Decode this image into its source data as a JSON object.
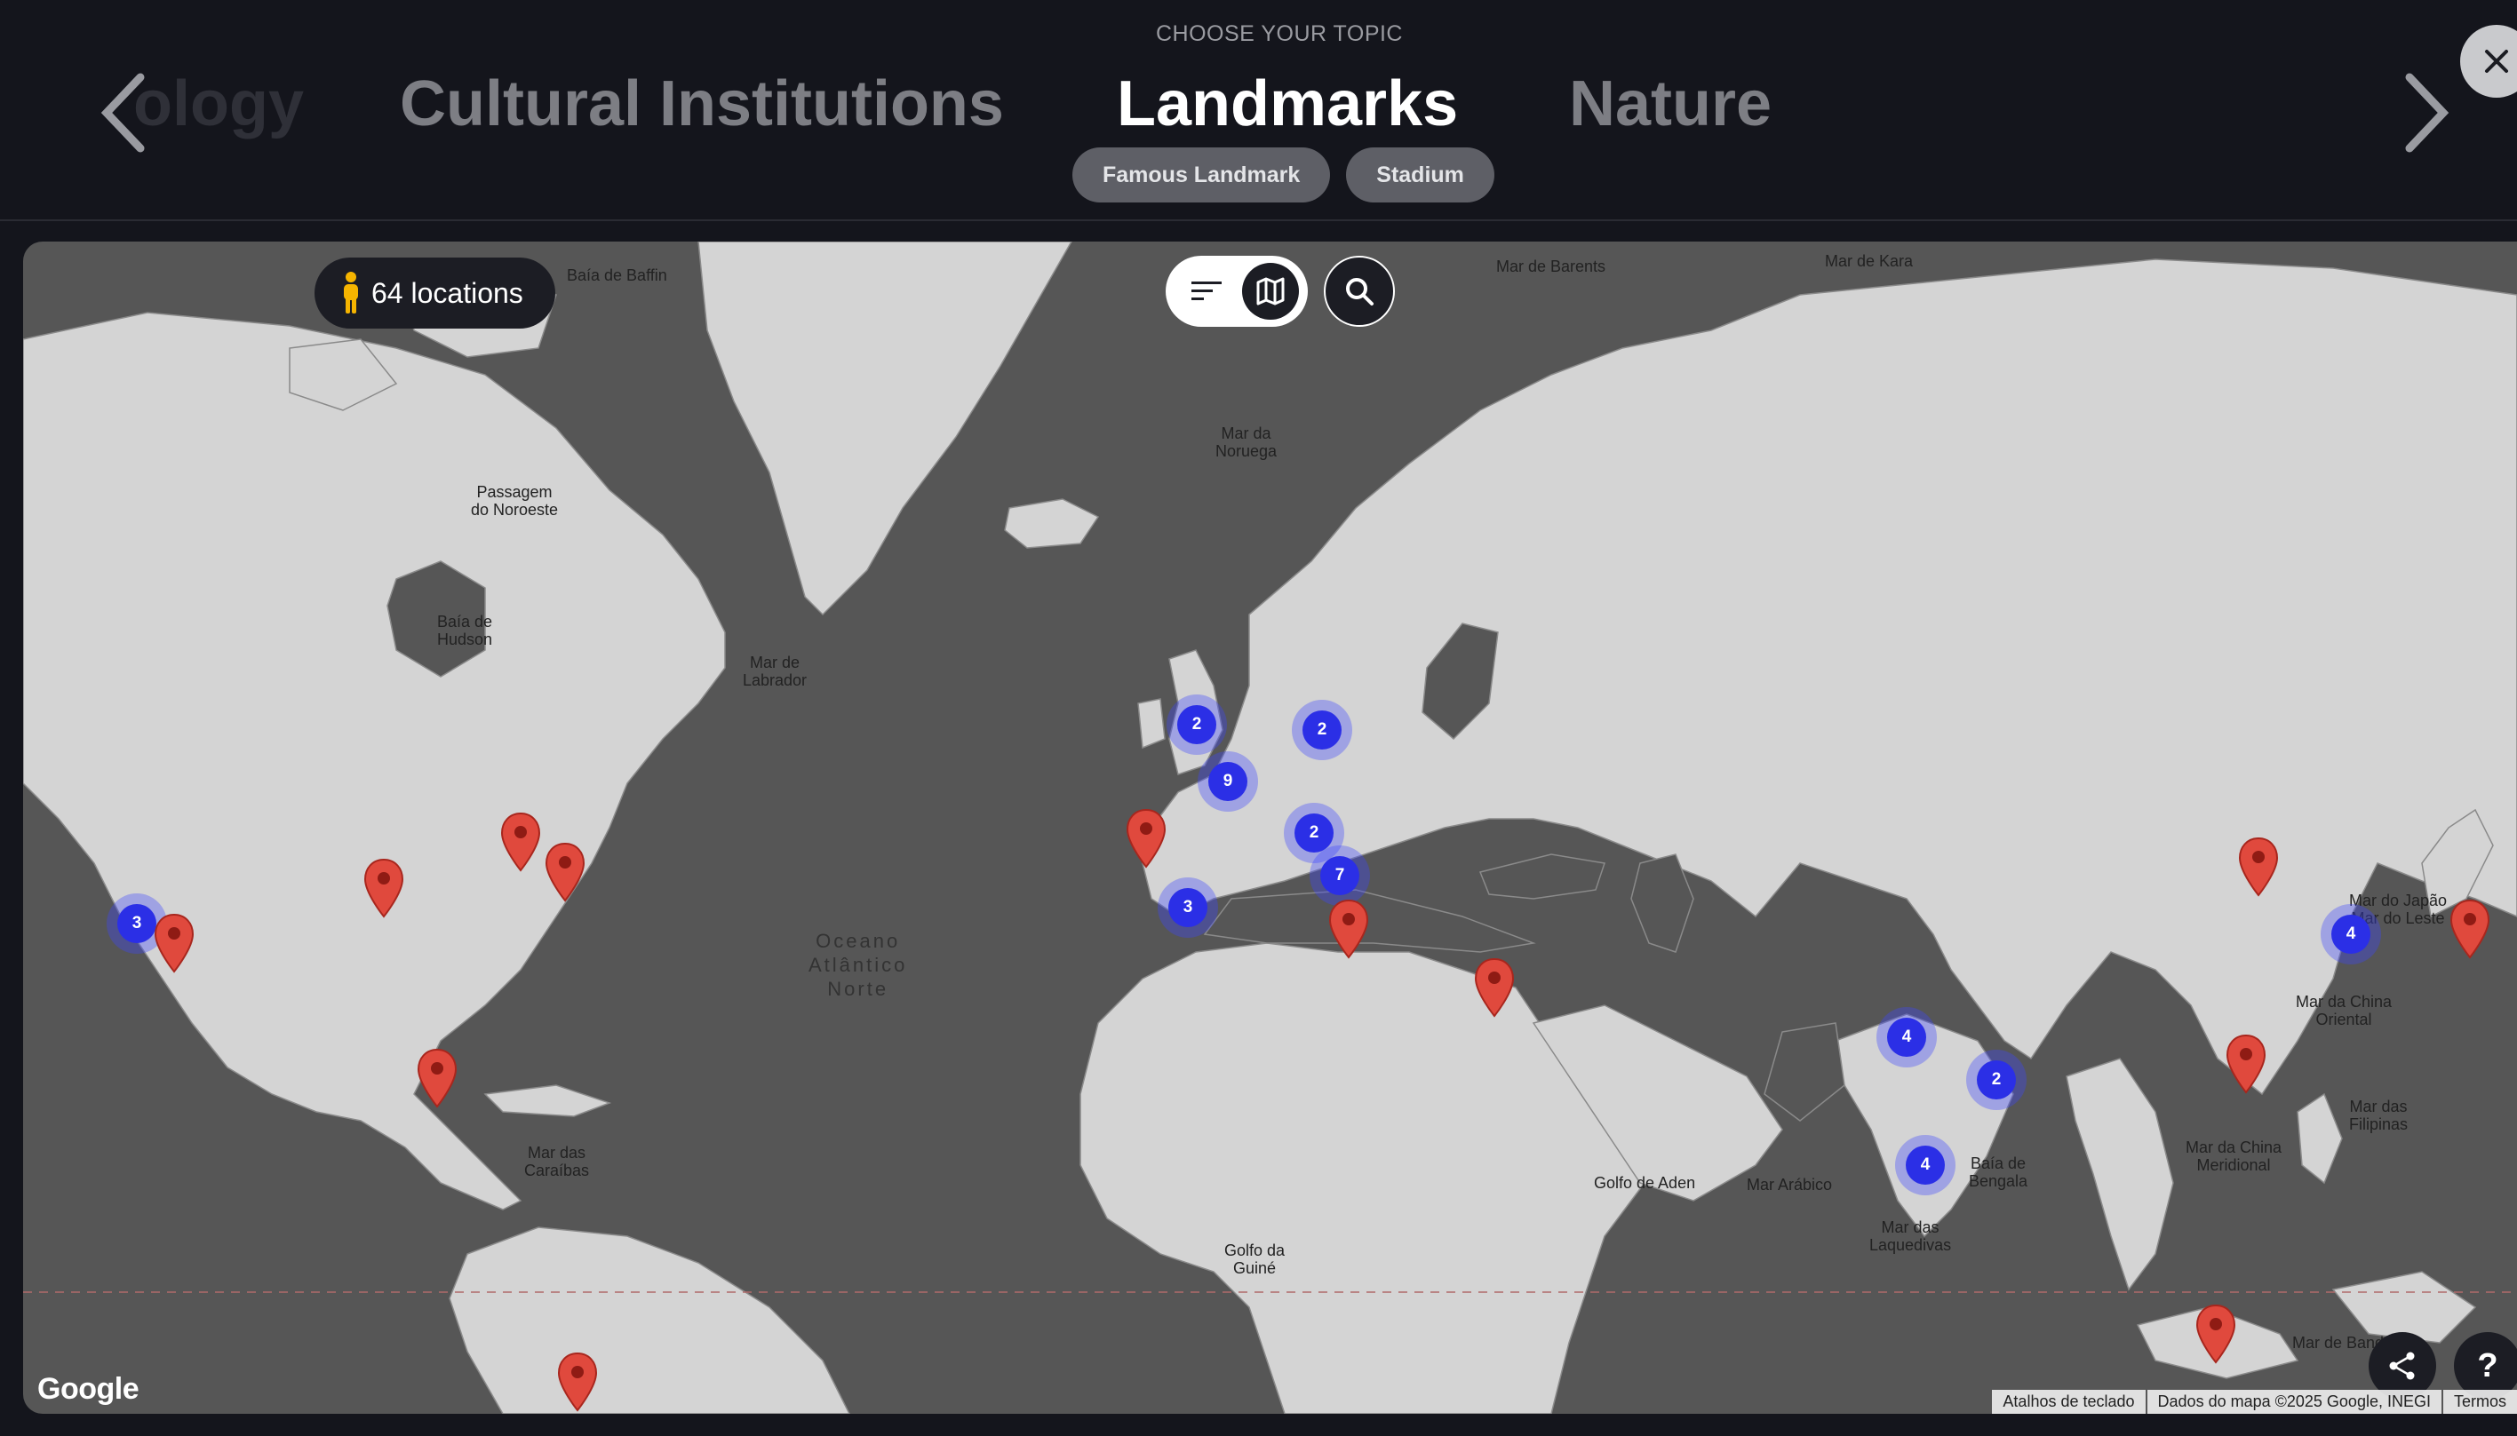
{
  "header": {
    "eyebrow": "CHOOSE YOUR TOPIC",
    "topics": [
      {
        "label": "ology",
        "state": "partial"
      },
      {
        "label": "Cultural Institutions",
        "state": "inactive"
      },
      {
        "label": "Landmarks",
        "state": "active"
      },
      {
        "label": "Nature",
        "state": "inactive"
      }
    ],
    "chips": [
      {
        "label": "Famous Landmark"
      },
      {
        "label": "Stadium"
      }
    ],
    "icons": {
      "prev": "chevron-left-icon",
      "next": "chevron-right-icon",
      "close": "close-icon"
    }
  },
  "map": {
    "locations_label": "64 locations",
    "icons": {
      "person": "person-icon",
      "filter": "filter-icon",
      "map": "map-icon",
      "search": "search-icon",
      "share": "share-icon"
    },
    "labels": [
      {
        "text": "Baía de Baffin"
      },
      {
        "text": "Mar de Barents"
      },
      {
        "text": "Mar de Kara"
      },
      {
        "text": "Mar da\nNoruega"
      },
      {
        "text": "Passagem\ndo Noroeste"
      },
      {
        "text": "Baía de\nHudson"
      },
      {
        "text": "Mar de\nLabrador"
      },
      {
        "text": "Oceano\nAtlântico\nNorte"
      },
      {
        "text": "Mar do Japão\nMar do Leste"
      },
      {
        "text": "Mar da China\nOriental"
      },
      {
        "text": "Mar das\nFilipinas"
      },
      {
        "text": "Mar da China\nMeridional"
      },
      {
        "text": "Mar das\nCaraíbas"
      },
      {
        "text": "Golfo de Aden"
      },
      {
        "text": "Mar Arábico"
      },
      {
        "text": "Baía de\nBengala"
      },
      {
        "text": "Mar das\nLaquedivas"
      },
      {
        "text": "Golfo da\nGuiné"
      },
      {
        "text": "Mar de Banda"
      }
    ],
    "clusters": [
      {
        "count": "3"
      },
      {
        "count": "2"
      },
      {
        "count": "2"
      },
      {
        "count": "9"
      },
      {
        "count": "2"
      },
      {
        "count": "7"
      },
      {
        "count": "3"
      },
      {
        "count": "4"
      },
      {
        "count": "2"
      },
      {
        "count": "4"
      },
      {
        "count": "4"
      }
    ],
    "pin_color": "#e0493d",
    "cluster_color": "#2b2fe6",
    "google_logo": "Google",
    "attribution": [
      "Atalhos de teclado",
      "Dados do mapa ©2025 Google, INEGI",
      "Termos"
    ],
    "help_label": "?"
  }
}
